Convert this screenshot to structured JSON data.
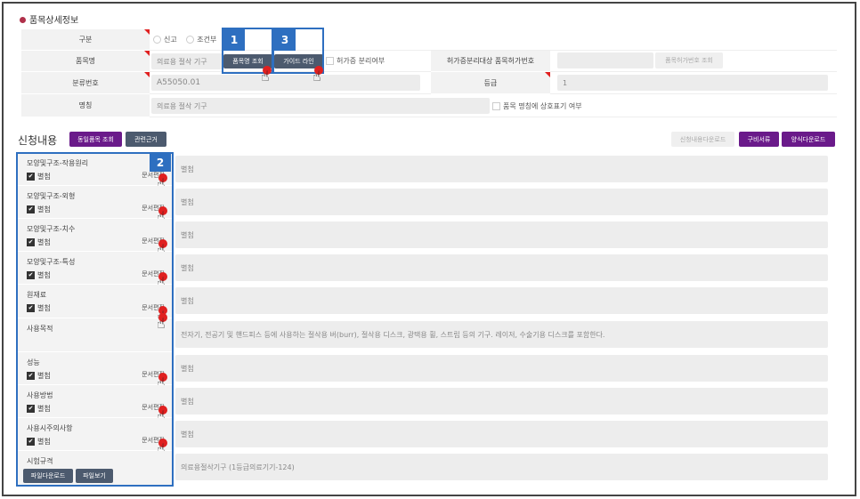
{
  "section_title": "품목상세정보",
  "fields": {
    "gubun": {
      "label": "구분",
      "options": [
        "신고",
        "조건부"
      ]
    },
    "item_name": {
      "label": "품목명",
      "value": "의료용 절삭 기구",
      "lookup_button": "품목명 조회",
      "guide_button": "가이드 라인",
      "separate_label": "허가증 분리여부"
    },
    "permit_no": {
      "label": "허가증분리대상 품목허가번호",
      "value": "",
      "lookup_button": "품목허가번호 조회"
    },
    "class_no": {
      "label": "분류번호",
      "value": "A55050.01"
    },
    "grade": {
      "label": "등급",
      "value": "1"
    },
    "name": {
      "label": "명칭",
      "value": "의료용 절삭 기구",
      "trade_label": "품목 명칭에 상호표기 여부"
    }
  },
  "application": {
    "title": "신청내용",
    "same_item_button": "동일품목 조회",
    "basis_button": "관련근거",
    "download_content_button": "신청내용다운로드",
    "documents_button": "구비서류",
    "form_download_button": "양식다운로드",
    "attach_label": "별첨",
    "edit_label": "문서편집",
    "rows": [
      {
        "label": "모양및구조-작용원리",
        "value": "별첨",
        "checkbox": true
      },
      {
        "label": "모양및구조-외형",
        "value": "별첨",
        "checkbox": true
      },
      {
        "label": "모양및구조-치수",
        "value": "별첨",
        "checkbox": true
      },
      {
        "label": "모양및구조-특성",
        "value": "별첨",
        "checkbox": true
      },
      {
        "label": "원재료",
        "value": "별첨",
        "checkbox": true
      },
      {
        "label": "사용목적",
        "value": "전자기, 전공기 및 핸드피스 등에 사용하는 절삭용 버(burr), 절삭용 디스크, 광택용 휠, 스트립 등의 기구. 레이저, 수술기용 디스크를 포함한다.",
        "checkbox": false
      },
      {
        "label": "성능",
        "value": "별첨",
        "checkbox": true
      },
      {
        "label": "사용방법",
        "value": "별첨",
        "checkbox": true
      },
      {
        "label": "사용시주의사항",
        "value": "별첨",
        "checkbox": true
      },
      {
        "label": "시험규격",
        "value": "의료용절삭기구 (1등급의료기기-124)",
        "checkbox": false
      }
    ],
    "file_download_button": "파일다운로드",
    "file_view_button": "파일보기"
  },
  "annotations": {
    "step1": "1",
    "step2": "2",
    "step3": "3"
  },
  "colors": {
    "purple": "#6a1a8a",
    "slate": "#4c5a6e",
    "annotation_blue": "#2e6fc0",
    "cursor_red": "#e02020"
  }
}
